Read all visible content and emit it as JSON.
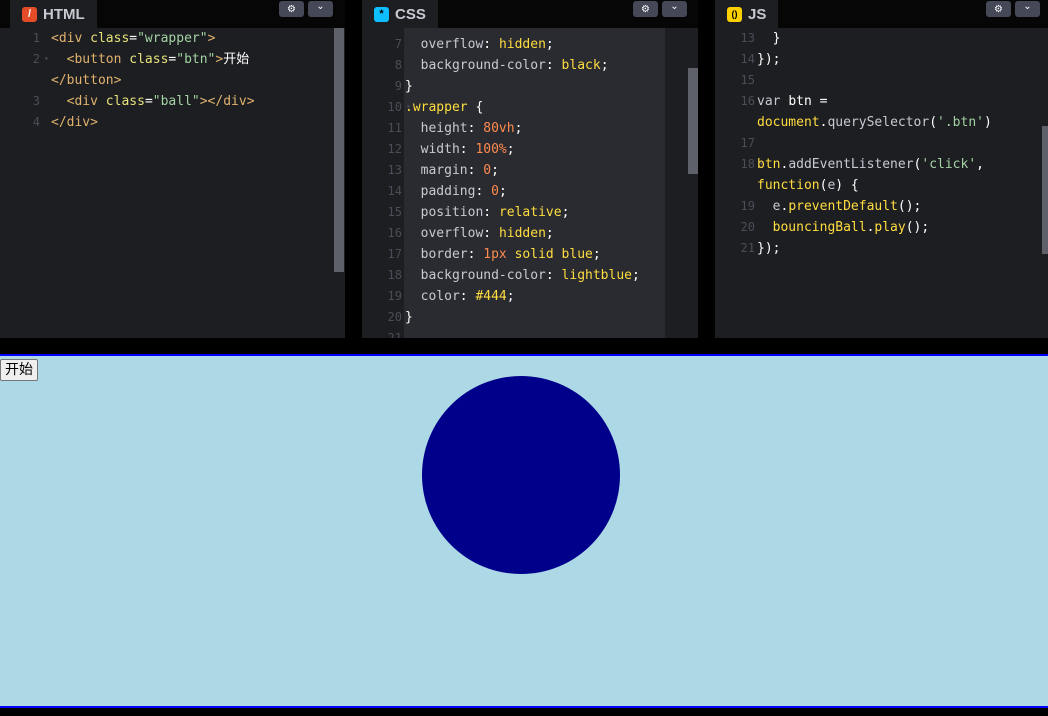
{
  "html_panel": {
    "title": "HTML",
    "icon": "/",
    "lines": [
      {
        "n": "1",
        "fold": false,
        "segs": [
          [
            "t-tag",
            "<div "
          ],
          [
            "t-attr",
            "class"
          ],
          [
            "t-plain",
            "="
          ],
          [
            "t-str",
            "\"wrapper\""
          ],
          [
            "t-tag",
            ">"
          ]
        ]
      },
      {
        "n": "2",
        "fold": true,
        "segs": [
          [
            "t-tag",
            "  <button "
          ],
          [
            "t-attr",
            "class"
          ],
          [
            "t-plain",
            "="
          ],
          [
            "t-str",
            "\"btn\""
          ],
          [
            "t-tag",
            ">"
          ],
          [
            "t-plain",
            "开始"
          ]
        ]
      },
      {
        "n": "",
        "fold": false,
        "segs": [
          [
            "t-tag",
            "</button>"
          ]
        ]
      },
      {
        "n": "3",
        "fold": false,
        "segs": [
          [
            "t-tag",
            "  <div "
          ],
          [
            "t-attr",
            "class"
          ],
          [
            "t-plain",
            "="
          ],
          [
            "t-str",
            "\"ball\""
          ],
          [
            "t-tag",
            "></div>"
          ]
        ]
      },
      {
        "n": "4",
        "fold": false,
        "segs": [
          [
            "t-tag",
            "</div>"
          ]
        ]
      }
    ]
  },
  "css_panel": {
    "title": "CSS",
    "icon": "*",
    "lines": [
      {
        "n": "7",
        "fold": false,
        "segs": [
          [
            "t-prop",
            "  overflow"
          ],
          [
            "t-punc",
            ": "
          ],
          [
            "t-val",
            "hidden"
          ],
          [
            "t-punc",
            ";"
          ]
        ]
      },
      {
        "n": "8",
        "fold": false,
        "segs": [
          [
            "t-prop",
            "  background-color"
          ],
          [
            "t-punc",
            ": "
          ],
          [
            "t-val",
            "black"
          ],
          [
            "t-punc",
            ";"
          ]
        ]
      },
      {
        "n": "9",
        "fold": false,
        "segs": [
          [
            "t-punc",
            "}"
          ]
        ]
      },
      {
        "n": "10",
        "fold": true,
        "segs": [
          [
            "t-sel",
            ".wrapper"
          ],
          [
            "t-punc",
            " {"
          ]
        ]
      },
      {
        "n": "11",
        "fold": false,
        "segs": [
          [
            "t-prop",
            "  height"
          ],
          [
            "t-punc",
            ": "
          ],
          [
            "t-num",
            "80vh"
          ],
          [
            "t-punc",
            ";"
          ]
        ]
      },
      {
        "n": "12",
        "fold": false,
        "segs": [
          [
            "t-prop",
            "  width"
          ],
          [
            "t-punc",
            ": "
          ],
          [
            "t-num",
            "100%"
          ],
          [
            "t-punc",
            ";"
          ]
        ]
      },
      {
        "n": "13",
        "fold": false,
        "segs": [
          [
            "t-prop",
            "  margin"
          ],
          [
            "t-punc",
            ": "
          ],
          [
            "t-num",
            "0"
          ],
          [
            "t-punc",
            ";"
          ]
        ]
      },
      {
        "n": "14",
        "fold": false,
        "segs": [
          [
            "t-prop",
            "  padding"
          ],
          [
            "t-punc",
            ": "
          ],
          [
            "t-num",
            "0"
          ],
          [
            "t-punc",
            ";"
          ]
        ]
      },
      {
        "n": "15",
        "fold": false,
        "segs": [
          [
            "t-prop",
            "  position"
          ],
          [
            "t-punc",
            ": "
          ],
          [
            "t-val",
            "relative"
          ],
          [
            "t-punc",
            ";"
          ]
        ]
      },
      {
        "n": "16",
        "fold": false,
        "segs": [
          [
            "t-prop",
            "  overflow"
          ],
          [
            "t-punc",
            ": "
          ],
          [
            "t-val",
            "hidden"
          ],
          [
            "t-punc",
            ";"
          ]
        ]
      },
      {
        "n": "17",
        "fold": false,
        "segs": [
          [
            "t-prop",
            "  border"
          ],
          [
            "t-punc",
            ": "
          ],
          [
            "t-num",
            "1px"
          ],
          [
            "t-val",
            " solid blue"
          ],
          [
            "t-punc",
            ";"
          ]
        ]
      },
      {
        "n": "18",
        "fold": false,
        "segs": [
          [
            "t-prop",
            "  background-color"
          ],
          [
            "t-punc",
            ": "
          ],
          [
            "t-val",
            "lightblue"
          ],
          [
            "t-punc",
            ";"
          ]
        ]
      },
      {
        "n": "19",
        "fold": false,
        "segs": [
          [
            "t-prop",
            "  color"
          ],
          [
            "t-punc",
            ": "
          ],
          [
            "t-val",
            "#444"
          ],
          [
            "t-punc",
            ";"
          ]
        ]
      },
      {
        "n": "20",
        "fold": false,
        "segs": [
          [
            "t-punc",
            "}"
          ]
        ]
      },
      {
        "n": "21",
        "fold": false,
        "segs": []
      }
    ]
  },
  "js_panel": {
    "title": "JS",
    "icon": "()",
    "lines": [
      {
        "n": "13",
        "fold": false,
        "segs": [
          [
            "t-punc",
            "  }"
          ]
        ]
      },
      {
        "n": "14",
        "fold": false,
        "segs": [
          [
            "t-punc",
            "});"
          ]
        ]
      },
      {
        "n": "15",
        "fold": false,
        "segs": []
      },
      {
        "n": "16",
        "fold": false,
        "segs": [
          [
            "t-var",
            "var "
          ],
          [
            "t-plain",
            "btn "
          ],
          [
            "t-punc",
            "="
          ]
        ]
      },
      {
        "n": "",
        "fold": false,
        "segs": [
          [
            "t-fn",
            "document"
          ],
          [
            "t-punc",
            "."
          ],
          [
            "t-var",
            "querySelector"
          ],
          [
            "t-punc",
            "("
          ],
          [
            "t-str2",
            "'.btn'"
          ],
          [
            "t-punc",
            ")"
          ]
        ]
      },
      {
        "n": "17",
        "fold": false,
        "segs": []
      },
      {
        "n": "18",
        "fold": true,
        "segs": [
          [
            "t-fn",
            "btn"
          ],
          [
            "t-punc",
            "."
          ],
          [
            "t-var",
            "addEventListener"
          ],
          [
            "t-punc",
            "("
          ],
          [
            "t-str2",
            "'click'"
          ],
          [
            "t-punc",
            ","
          ]
        ]
      },
      {
        "n": "",
        "fold": false,
        "segs": [
          [
            "t-fn",
            "function"
          ],
          [
            "t-punc",
            "("
          ],
          [
            "t-var",
            "e"
          ],
          [
            "t-punc",
            ") {"
          ]
        ]
      },
      {
        "n": "19",
        "fold": false,
        "segs": [
          [
            "t-var",
            "  e"
          ],
          [
            "t-punc",
            "."
          ],
          [
            "t-fn",
            "preventDefault"
          ],
          [
            "t-punc",
            "();"
          ]
        ]
      },
      {
        "n": "20",
        "fold": false,
        "segs": [
          [
            "t-fn",
            "  bouncingBall"
          ],
          [
            "t-punc",
            "."
          ],
          [
            "t-fn",
            "play"
          ],
          [
            "t-punc",
            "();"
          ]
        ]
      },
      {
        "n": "21",
        "fold": false,
        "segs": [
          [
            "t-punc",
            "});"
          ]
        ]
      }
    ]
  },
  "header_buttons": {
    "settings_icon": "gear-icon",
    "settings_glyph": "⚙",
    "chevron_icon": "chevron-down-icon",
    "chevron_glyph": "⌄"
  },
  "preview": {
    "button_label": "开始",
    "background": "#add8e6",
    "ball_color": "#00008b",
    "border_color": "#0000ff"
  },
  "colors": {
    "html_icon_bg": "#e34c26",
    "css_icon_bg": "#0ebeff",
    "js_icon_bg": "#fcd000"
  }
}
